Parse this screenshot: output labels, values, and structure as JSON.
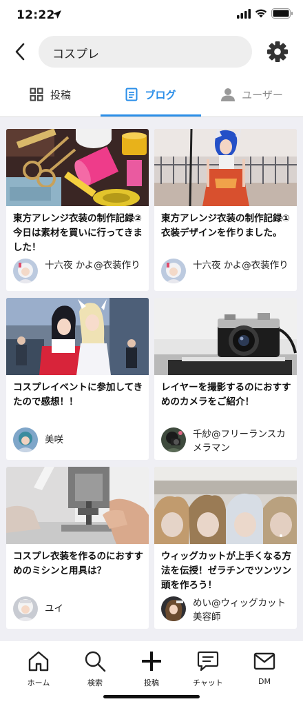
{
  "status": {
    "time": "12:22"
  },
  "search": {
    "query": "コスプレ"
  },
  "tabs": [
    {
      "label": "投稿",
      "icon": "grid-icon"
    },
    {
      "label": "ブログ",
      "icon": "document-icon"
    },
    {
      "label": "ユーザー",
      "icon": "person-icon"
    }
  ],
  "cards": [
    {
      "title": "東方アレンジ衣装の制作記録② 今日は素材を買いに行ってきました！",
      "author": "十六夜 かよ@衣装作り"
    },
    {
      "title": "東方アレンジ衣装の制作記録①衣装デザインを作りました。",
      "author": "十六夜 かよ@衣装作り"
    },
    {
      "title": "コスプレイベントに参加してきたので感想！！",
      "author": "美咲"
    },
    {
      "title": "レイヤーを撮影するのにおすすめのカメラをご紹介！",
      "author": "千紗@フリーランスカメラマン"
    },
    {
      "title": "コスプレ衣装を作るのにおすすめのミシンと用具は？",
      "author": "ユイ"
    },
    {
      "title": "ウィッグカットが上手くなる方法を伝授！ゼラチンでツンツン頭を作ろう！",
      "author": "めい@ウィッグカット美容師"
    }
  ],
  "nav": [
    {
      "label": "ホーム",
      "icon": "home-icon"
    },
    {
      "label": "検索",
      "icon": "search-icon"
    },
    {
      "label": "投稿",
      "icon": "plus-icon"
    },
    {
      "label": "チャット",
      "icon": "chat-icon"
    },
    {
      "label": "DM",
      "icon": "mail-icon"
    }
  ],
  "colors": {
    "accent": "#2a8ee8",
    "background": "#efeff4"
  }
}
